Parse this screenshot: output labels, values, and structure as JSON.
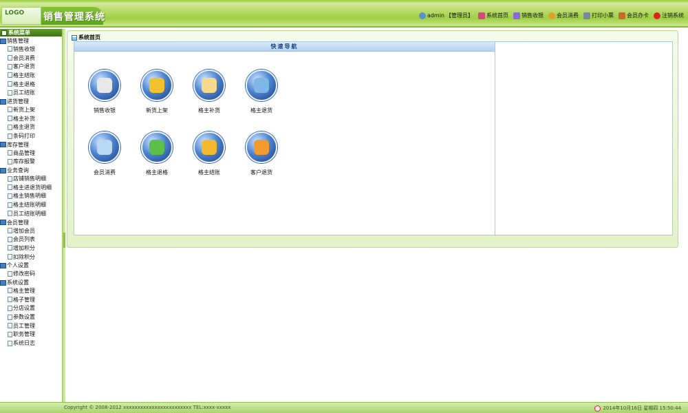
{
  "header": {
    "logo_text": "LOGO",
    "logo_sub": "",
    "app_title": "销售管理系统",
    "user": "admin",
    "role": "【管理员】",
    "nav": [
      {
        "label": "系统首页",
        "icon": "home-icon"
      },
      {
        "label": "销售收银",
        "icon": "cashier-icon"
      },
      {
        "label": "会员消费",
        "icon": "member-icon"
      },
      {
        "label": "打印小票",
        "icon": "print-icon"
      },
      {
        "label": "会员办卡",
        "icon": "card-icon"
      },
      {
        "label": "注销系统",
        "icon": "logout-icon"
      }
    ]
  },
  "sidebar": {
    "title": "系统菜单",
    "groups": [
      {
        "title": "销售管理",
        "items": [
          "销售收银",
          "会员消费",
          "客户退货",
          "格主结账",
          "格主退格",
          "员工结账"
        ]
      },
      {
        "title": "进货管理",
        "items": [
          "新货上架",
          "格主补货",
          "格主退货",
          "条码打印"
        ]
      },
      {
        "title": "库存管理",
        "items": [
          "商品管理",
          "库存报警"
        ]
      },
      {
        "title": "业务查询",
        "items": [
          "店铺销售明细",
          "格主进退货明细",
          "格主销售明细",
          "格主结账明细",
          "员工结账明细"
        ]
      },
      {
        "title": "会员管理",
        "items": [
          "增加会员",
          "会员列表",
          "增加积分",
          "扣除积分"
        ]
      },
      {
        "title": "个人设置",
        "items": [
          "修改密码"
        ]
      },
      {
        "title": "系统设置",
        "items": [
          "格主管理",
          "格子管理",
          "分店设置",
          "参数设置",
          "员工管理",
          "职务管理",
          "系统日志"
        ]
      }
    ]
  },
  "main": {
    "panel_title": "系统首页",
    "quicknav_title": "快速导航",
    "shortcuts": [
      {
        "label": "销售收银",
        "color": "#e8e8e8"
      },
      {
        "label": "新货上架",
        "color": "#f2c12e"
      },
      {
        "label": "格主补货",
        "color": "#f6d98a"
      },
      {
        "label": "格主退货",
        "color": "#7fb8e8"
      },
      {
        "label": "会员消费",
        "color": "#b9d9f2"
      },
      {
        "label": "格主退格",
        "color": "#5cbf4a"
      },
      {
        "label": "格主结账",
        "color": "#f2b92e"
      },
      {
        "label": "客户退货",
        "color": "#f29a2e"
      }
    ]
  },
  "footer": {
    "copyright": "Copyright © 2008-2012 xxxxxxxxxxxxxxxxxxxxxxxx TEL:xxxx-xxxxx",
    "datetime": "2014年10月16日 星期四 15:50:44"
  }
}
